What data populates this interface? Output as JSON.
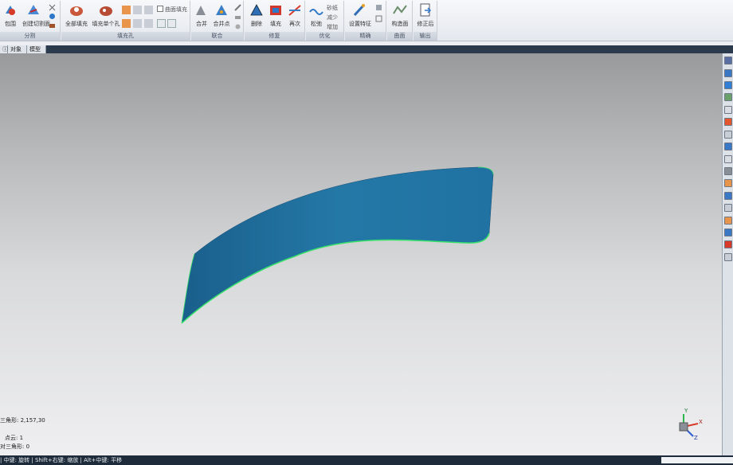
{
  "ribbon": {
    "groups": [
      {
        "caption": "分割",
        "buttons": [
          "包围",
          "创建切割面"
        ]
      },
      {
        "caption": "填充孔",
        "buttons": [
          "全部填充",
          "填充单个孔"
        ],
        "option_label": "曲面填充"
      },
      {
        "caption": "联合",
        "buttons": [
          "合并",
          "合并点"
        ]
      },
      {
        "caption": "修复",
        "buttons": [
          "删除",
          "填充",
          "再次"
        ]
      },
      {
        "caption": "优化",
        "buttons": [
          "松弛"
        ],
        "side_items": [
          "砂纸",
          "减少",
          "增加"
        ]
      },
      {
        "caption": "精确",
        "buttons": [
          "设置特征"
        ]
      },
      {
        "caption": "曲面",
        "buttons": [
          "构造面"
        ]
      },
      {
        "caption": "输出",
        "buttons": [
          "修正后"
        ]
      }
    ]
  },
  "tabs": [
    "ⓘ",
    "对象",
    "模型"
  ],
  "viewport": {
    "info_lines": [
      "三角形: 2,157,30",
      "点云: 1",
      "对三角形: 0"
    ],
    "axis_labels": {
      "x": "X",
      "y": "Y",
      "z": "Z"
    }
  },
  "status_bar": {
    "text": "| 中键: 旋转 | Shift+右键: 缩放 | Alt+中键: 平移"
  },
  "colors": {
    "surface": "#1f72a2",
    "surface_edge": "#39e36b",
    "status_bg": "#1e2b3a",
    "ribbon_caption": "#c7cdd7"
  }
}
